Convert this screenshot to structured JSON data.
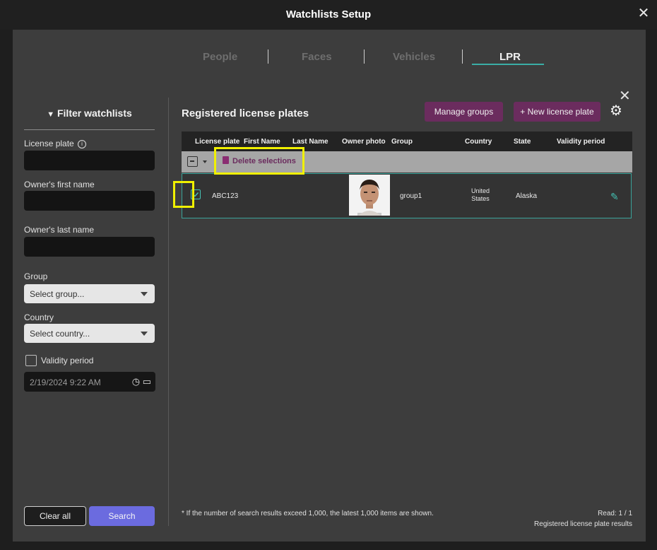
{
  "window": {
    "title": "Watchlists Setup",
    "close_icon": "close-icon"
  },
  "tabs": [
    {
      "label": "People",
      "active": false
    },
    {
      "label": "Faces",
      "active": false
    },
    {
      "label": "Vehicles",
      "active": false
    },
    {
      "label": "LPR",
      "active": true
    }
  ],
  "filter": {
    "heading": "Filter watchlists",
    "license_plate_label": "License plate",
    "license_plate_value": "",
    "first_name_label": "Owner's first name",
    "first_name_value": "",
    "last_name_label": "Owner's last name",
    "last_name_value": "",
    "group_label": "Group",
    "group_placeholder": "Select group...",
    "country_label": "Country",
    "country_placeholder": "Select country...",
    "validity_label": "Validity period",
    "validity_checked": false,
    "datetime_value": "2/19/2024 9:22 AM",
    "clear_label": "Clear all",
    "search_label": "Search"
  },
  "main": {
    "title": "Registered license plates",
    "manage_groups_label": "Manage groups",
    "new_plate_label": "+ New license plate",
    "columns": [
      "License plate",
      "First Name",
      "Last Name",
      "Owner photo",
      "Group",
      "Country",
      "State",
      "Validity period"
    ],
    "delete_selections_label": "Delete selections",
    "rows": [
      {
        "checked": true,
        "license_plate": "ABC123",
        "first_name": "",
        "last_name": "",
        "group": "group1",
        "country_line1": "United",
        "country_line2": "States",
        "state": "Alaska",
        "validity_period": ""
      }
    ],
    "footnote": "* If the number of search results exceed 1,000, the latest 1,000 items are shown.",
    "read_count": "Read: 1 / 1",
    "results_label": "Registered license plate results"
  },
  "colors": {
    "accent_teal": "#3aaea6",
    "button_plum": "#6b2c5e",
    "search_blue": "#6b6bdf",
    "highlight_yellow": "#f0f000"
  }
}
